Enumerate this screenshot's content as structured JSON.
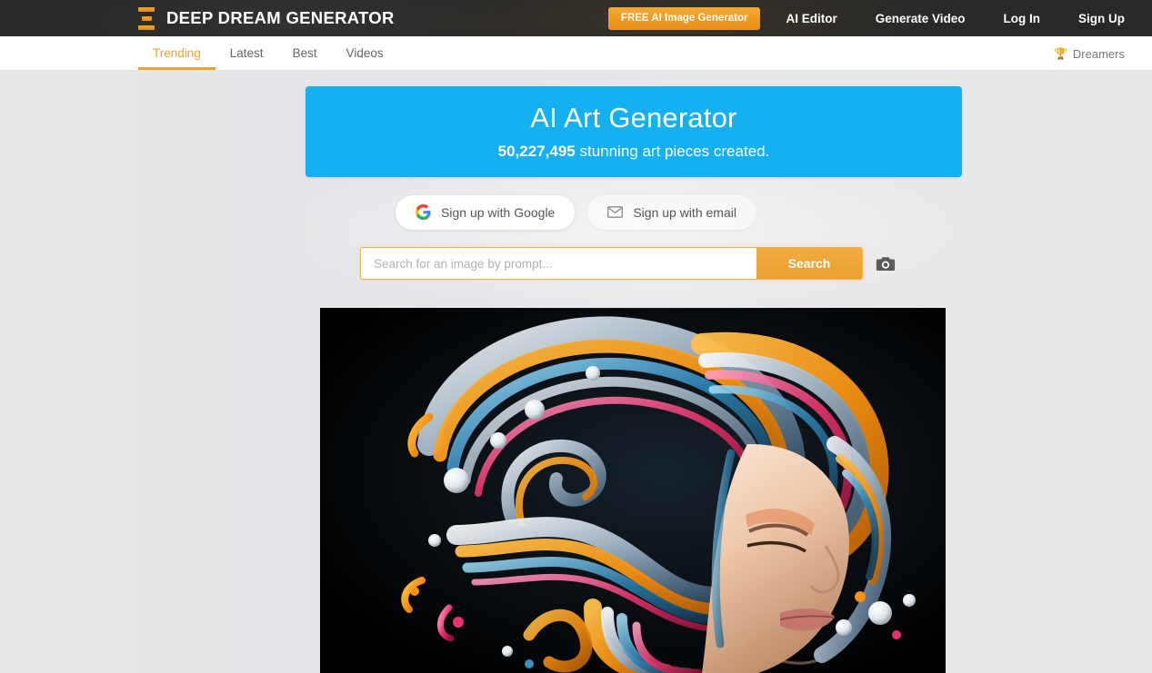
{
  "topbar": {
    "brand_name": "DEEP DREAM GENERATOR",
    "logo_icon": "hourglass-stack-icon",
    "free_button": "FREE AI Image Generator",
    "links": [
      {
        "label": "AI Editor",
        "name": "ai-editor"
      },
      {
        "label": "Generate Video",
        "name": "generate-video"
      },
      {
        "label": "Log In",
        "name": "log-in"
      },
      {
        "label": "Sign Up",
        "name": "sign-up"
      }
    ]
  },
  "subnav": {
    "tabs": [
      {
        "label": "Trending",
        "active": true
      },
      {
        "label": "Latest",
        "active": false
      },
      {
        "label": "Best",
        "active": false
      },
      {
        "label": "Videos",
        "active": false
      }
    ],
    "dreamers_label": "Dreamers",
    "dreamers_icon": "trophy-icon"
  },
  "hero": {
    "title": "AI Art Generator",
    "count": "50,227,495",
    "subtitle_rest": " stunning art pieces created.",
    "background_color": "#15b0ef"
  },
  "signup": {
    "google_label": "Sign up with Google",
    "google_icon": "google-g-icon",
    "email_label": "Sign up with email",
    "email_icon": "envelope-icon"
  },
  "search": {
    "placeholder": "Search for an image by prompt...",
    "value": "",
    "button_label": "Search",
    "camera_icon": "camera-icon"
  },
  "artwork": {
    "alt": "AI generated portrait of a woman with flowing swirling multicolor hair on black background",
    "background_color": "#000000"
  },
  "colors": {
    "accent_orange": "#f0a12e",
    "brand_blue": "#15b0ef",
    "navbar_dark": "#282828",
    "page_background": "#e8e8ea"
  }
}
